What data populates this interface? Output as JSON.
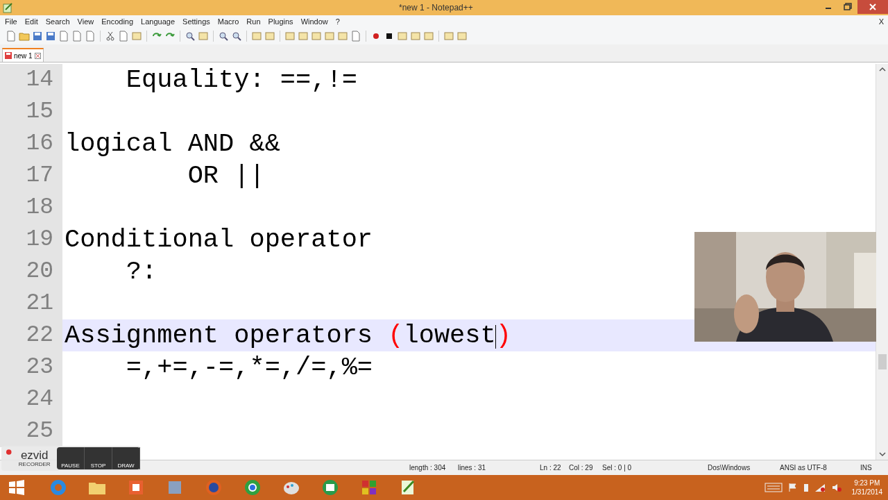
{
  "window": {
    "title": "*new  1 - Notepad++"
  },
  "menu": [
    "File",
    "Edit",
    "Search",
    "View",
    "Encoding",
    "Language",
    "Settings",
    "Macro",
    "Run",
    "Plugins",
    "Window",
    "?"
  ],
  "menu_close": "X",
  "tabs": [
    {
      "label": "new 1",
      "selected": true
    }
  ],
  "editor": {
    "lines": [
      {
        "number": "14",
        "current": false,
        "segments": [
          {
            "text": "    Equality: ==,!=",
            "brace": false
          }
        ]
      },
      {
        "number": "15",
        "current": false
      },
      {
        "number": "16",
        "current": false,
        "segments": [
          {
            "text": "logical AND &&",
            "brace": false
          }
        ]
      },
      {
        "number": "17",
        "current": false,
        "segments": [
          {
            "text": "        OR ||",
            "brace": false
          }
        ]
      },
      {
        "number": "18",
        "current": false
      },
      {
        "number": "19",
        "current": false,
        "segments": [
          {
            "text": "Conditional operator",
            "brace": false
          }
        ]
      },
      {
        "number": "20",
        "current": false,
        "segments": [
          {
            "text": "    ?:",
            "brace": false
          }
        ]
      },
      {
        "number": "21",
        "current": false
      },
      {
        "number": "22",
        "current": true,
        "segments": [
          {
            "text": "Assignment operators ",
            "brace": false
          },
          {
            "text": "(",
            "brace": true
          },
          {
            "text": "lowest",
            "brace": false
          },
          {
            "text": ")",
            "brace": true
          }
        ]
      },
      {
        "number": "23",
        "current": false,
        "segments": [
          {
            "text": "    =,+=,-=,*=,/=,%=",
            "brace": false
          }
        ]
      },
      {
        "number": "24",
        "current": false
      },
      {
        "number": "25",
        "current": false
      }
    ]
  },
  "status_bar": [
    "length : 304",
    "lines : 31",
    "Ln : 22",
    "Col : 29",
    "Sel : 0 | 0",
    "Dos\\Windows",
    "ANSI as UTF-8",
    "INS"
  ],
  "recorder": {
    "logo": "ezvid",
    "sublabel": "RECORDER",
    "buttons": [
      "PAUSE",
      "STOP",
      "DRAW"
    ]
  },
  "taskbar": {
    "time": "9:23 PM",
    "date": "1/31/2014"
  }
}
